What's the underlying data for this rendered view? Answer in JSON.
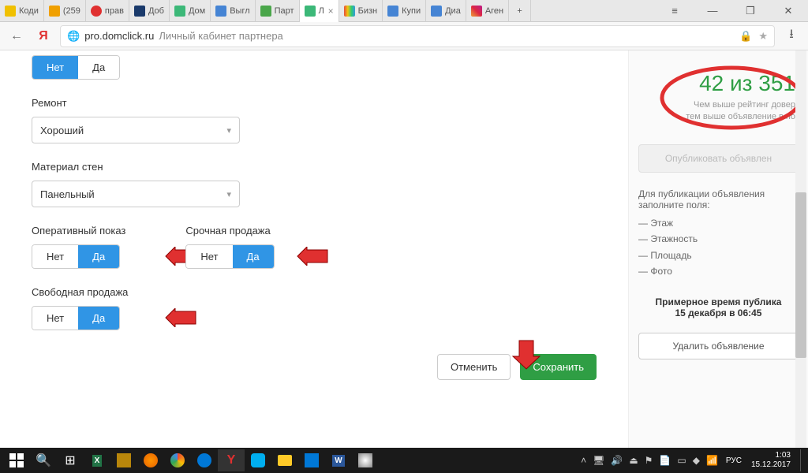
{
  "browser": {
    "tabs": [
      {
        "label": "Коди"
      },
      {
        "label": "(259"
      },
      {
        "label": "прав"
      },
      {
        "label": "Доб"
      },
      {
        "label": "Дом"
      },
      {
        "label": "Выгл"
      },
      {
        "label": "Парт"
      },
      {
        "label": "Л"
      },
      {
        "label": "Бизн"
      },
      {
        "label": "Купи"
      },
      {
        "label": "Диа"
      },
      {
        "label": "Аген"
      }
    ],
    "url_domain": "pro.domclick.ru",
    "url_path": "Личный кабинет партнера"
  },
  "form": {
    "top_no": "Нет",
    "top_yes": "Да",
    "repair_label": "Ремонт",
    "repair_value": "Хороший",
    "wall_label": "Материал стен",
    "wall_value": "Панельный",
    "operative_label": "Оперативный показ",
    "urgent_label": "Срочная продажа",
    "free_label": "Свободная продажа",
    "no": "Нет",
    "yes": "Да",
    "cancel": "Отменить",
    "save": "Сохранить"
  },
  "sidebar": {
    "rating": "42 из 351",
    "rating_hint1": "Чем выше рейтинг довер",
    "rating_hint2": "тем выше объявление в по",
    "publish": "Опубликовать объявлен",
    "req_title": "Для публикации объявления заполните поля:",
    "req1": "— Этаж",
    "req2": "— Этажность",
    "req3": "— Площадь",
    "req4": "— Фото",
    "pub_time1": "Примерное время публика",
    "pub_time2": "15 декабря в 06:45",
    "delete": "Удалить объявление"
  },
  "taskbar": {
    "lang": "РУС",
    "time": "1:03",
    "date": "15.12.2017"
  }
}
